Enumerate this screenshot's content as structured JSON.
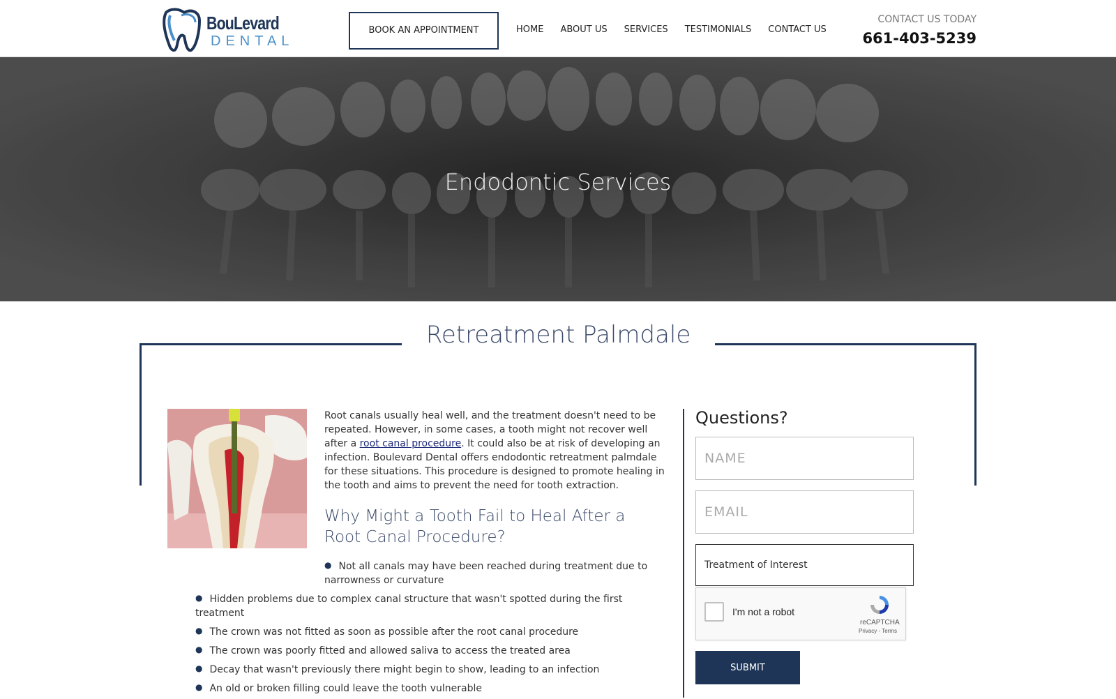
{
  "header": {
    "logo_word1": "BouLevard",
    "logo_word2": "DENTAL",
    "book_label": "BOOK AN APPOINTMENT",
    "nav": [
      "HOME",
      "ABOUT US",
      "SERVICES",
      "TESTIMONIALS",
      "CONTACT US"
    ],
    "contact_today": "CONTACT US TODAY",
    "phone": "661-403-5239"
  },
  "hero": {
    "title": "Endodontic Services"
  },
  "section": {
    "title": "Retreatment Palmdale"
  },
  "content": {
    "para_before_link": "Root canals usually heal well, and the treatment doesn't need to be repeated. However, in some cases, a tooth might not recover well after a ",
    "link_text": "root canal procedure",
    "para_after_link": ". It could also be at risk of developing an infection. Boulevard Dental offers endodontic retreatment palmdale for these situations. This procedure is designed to promote healing in the tooth and aims to prevent the need for tooth extraction.",
    "sub_heading": "Why Might a Tooth Fail to Heal After a Root Canal Procedure?",
    "bullets": [
      "Not all canals may have been reached during treatment due to narrowness or curvature",
      "Hidden problems due to complex canal structure that wasn't spotted during the first treatment",
      "The crown was not fitted as soon as possible after the root canal procedure",
      "The crown was poorly fitted and allowed saliva to access the treated area",
      "Decay that wasn't previously there might begin to show, leading to an infection",
      "An old or broken filling could leave the tooth vulnerable"
    ]
  },
  "form": {
    "title": "Questions?",
    "name_placeholder": "NAME",
    "email_placeholder": "EMAIL",
    "treatment_label": "Treatment of Interest",
    "captcha_label": "I'm not a robot",
    "captcha_brand": "reCAPTCHA",
    "captcha_terms": "Privacy - Terms",
    "submit_label": "SUBMIT"
  },
  "colors": {
    "navy": "#1e3557",
    "link": "#1e2b7a",
    "heading": "#3a4a6a"
  }
}
